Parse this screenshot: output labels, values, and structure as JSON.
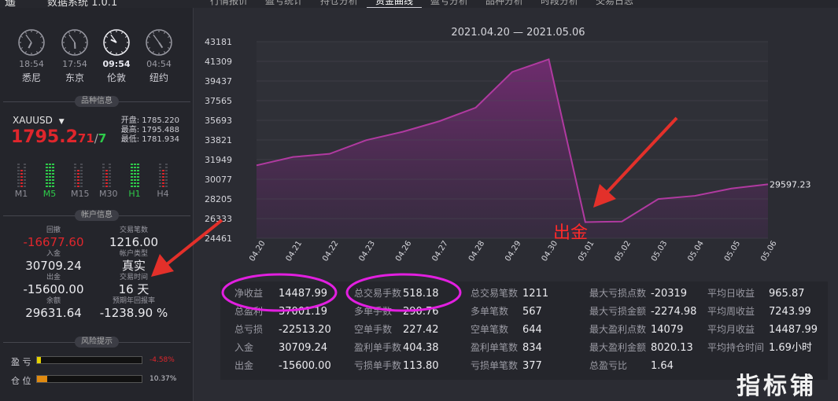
{
  "topbar": {
    "logo": "遥",
    "title": "数据系统 1.0.1",
    "tabs": [
      {
        "label": "行情报价"
      },
      {
        "label": "盈亏统计"
      },
      {
        "label": "持仓分析"
      },
      {
        "label": "资金曲线",
        "active": true
      },
      {
        "label": "盈亏分析"
      },
      {
        "label": "品种分析"
      },
      {
        "label": "时段分析"
      },
      {
        "label": "交易日志"
      }
    ]
  },
  "clocks": [
    {
      "time": "18:54",
      "city": "悉尼",
      "hour": 6,
      "minute": 54
    },
    {
      "time": "17:54",
      "city": "东京",
      "hour": 5,
      "minute": 54
    },
    {
      "time": "09:54",
      "city": "伦敦",
      "hour": 9,
      "minute": 54,
      "active": true
    },
    {
      "time": "04:54",
      "city": "纽约",
      "hour": 4,
      "minute": 54
    }
  ],
  "symbol_section": {
    "header": "品种信息",
    "symbol": "XAUUSD",
    "price_main": "1795.2",
    "price_digits": "71",
    "price_sep": "/",
    "price_tail": "7",
    "open": "开盘: 1785.220",
    "high": "最高: 1795.488",
    "low": "最低: 1781.934",
    "timeframes": [
      {
        "label": "M1",
        "up": false
      },
      {
        "label": "M5",
        "up": true
      },
      {
        "label": "M15",
        "up": false
      },
      {
        "label": "M30",
        "up": false
      },
      {
        "label": "H1",
        "up": true
      },
      {
        "label": "H4",
        "up": false
      }
    ]
  },
  "account": {
    "header": "帐户信息",
    "drawdown_label": "回撤",
    "drawdown": "-16677.60",
    "trades_label": "交易笔数",
    "trades": "1216.00",
    "deposit_label": "入金",
    "deposit": "30709.24",
    "type_label": "帐户类型",
    "type": "真实",
    "withdraw_label": "出金",
    "withdraw": "-15600.00",
    "time_label": "交易时间",
    "time": "16 天",
    "balance_label": "余额",
    "balance": "29631.64",
    "annual_label": "预期年回报率",
    "annual": "-1238.90 %"
  },
  "risk": {
    "header": "风险提示",
    "pnl_label": "盈 亏",
    "pnl_value": "-4.58%",
    "pnl_fraction": 0.04,
    "pos_label": "仓 位",
    "pos_value": "10.37%",
    "pos_fraction": 0.1
  },
  "colors": {
    "accent_red": "#e0262c",
    "accent_green": "#2ecb4a",
    "curve": "#b03aa0",
    "highlight_circle": "#e21fe0"
  },
  "annotation": {
    "text": "出金"
  },
  "watermark": "指标铺",
  "chart_data": {
    "type": "area",
    "title": "2021.04.20 — 2021.05.06",
    "ylim": [
      24461,
      43181
    ],
    "yticks": [
      "43181",
      "41309",
      "39437",
      "37565",
      "35693",
      "33821",
      "31949",
      "30077",
      "28205",
      "26333",
      "24461"
    ],
    "categories": [
      "04.20",
      "04.21",
      "04.22",
      "04.23",
      "04.26",
      "04.27",
      "04.28",
      "04.29",
      "04.30",
      "05.01",
      "05.02",
      "05.03",
      "05.04",
      "05.05",
      "05.06"
    ],
    "x": [
      0,
      1,
      2,
      3,
      4,
      4.9,
      5.8,
      6.4,
      7.5,
      7.95,
      8.5,
      9.1,
      10.0,
      11.0,
      12.0,
      13.0,
      14.0
    ],
    "values": [
      31400,
      32200,
      32500,
      33800,
      34600,
      35600,
      36900,
      40300,
      41500,
      26000,
      26050,
      28200,
      28500,
      29200,
      29597.23
    ],
    "last_label": "29597.23",
    "grid": true
  },
  "stats": {
    "columns": [
      [
        {
          "k": "净收益",
          "v": "14487.99"
        },
        {
          "k": "总盈利",
          "v": "37001.19"
        },
        {
          "k": "总亏损",
          "v": "-22513.20"
        },
        {
          "k": "入金",
          "v": "30709.24"
        },
        {
          "k": "出金",
          "v": "-15600.00"
        }
      ],
      [
        {
          "k": "总交易手数",
          "v": "518.18"
        },
        {
          "k": "多单手数",
          "v": "290.76"
        },
        {
          "k": "空单手数",
          "v": "227.42"
        },
        {
          "k": "盈利单手数",
          "v": "404.38"
        },
        {
          "k": "亏损单手数",
          "v": "113.80"
        }
      ],
      [
        {
          "k": "总交易笔数",
          "v": "1211"
        },
        {
          "k": "多单笔数",
          "v": "567"
        },
        {
          "k": "空单笔数",
          "v": "644"
        },
        {
          "k": "盈利单笔数",
          "v": "834"
        },
        {
          "k": "亏损单笔数",
          "v": "377"
        }
      ],
      [
        {
          "k": "最大亏损点数",
          "v": "-20319"
        },
        {
          "k": "最大亏损金额",
          "v": "-2274.98"
        },
        {
          "k": "最大盈利点数",
          "v": "14079"
        },
        {
          "k": "最大盈利金额",
          "v": "8020.13"
        },
        {
          "k": "总盈亏比",
          "v": "1.64"
        }
      ],
      [
        {
          "k": "平均日收益",
          "v": "965.87"
        },
        {
          "k": "平均周收益",
          "v": "7243.99"
        },
        {
          "k": "平均月收益",
          "v": "14487.99"
        },
        {
          "k": "平均持仓时间",
          "v": "1.69小时"
        }
      ]
    ]
  }
}
